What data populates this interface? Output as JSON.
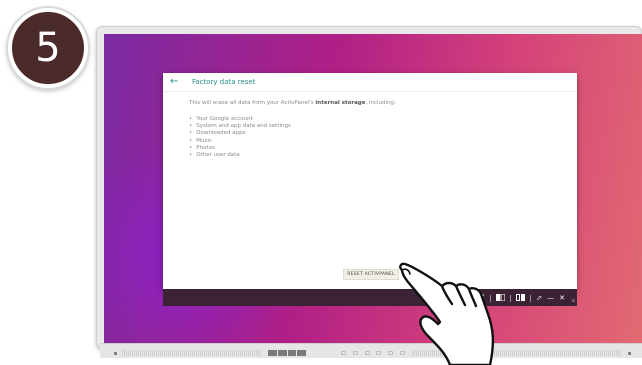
{
  "step": {
    "number": "5"
  },
  "dialog": {
    "title": "Factory data reset",
    "intro_before": "This will erase all data from your ActivPanel's ",
    "intro_bold": "internal storage",
    "intro_after": ", including:",
    "items": [
      "Your Google account",
      "System and app data and settings",
      "Downloaded apps",
      "Music",
      "Photos",
      "Other user data"
    ],
    "reset_button": "RESET ACTIVPANEL"
  },
  "navbar": {
    "icons": [
      "back-icon",
      "split-left-icon",
      "split-right-icon",
      "expand-icon",
      "minimize-icon",
      "close-icon",
      "resize-icon"
    ]
  },
  "colors": {
    "accent": "#2a8c8c",
    "navbar": "#3b2335",
    "badge": "#4a2a2a",
    "gradient_start": "#7a2aa2",
    "gradient_end": "#e26a72"
  }
}
